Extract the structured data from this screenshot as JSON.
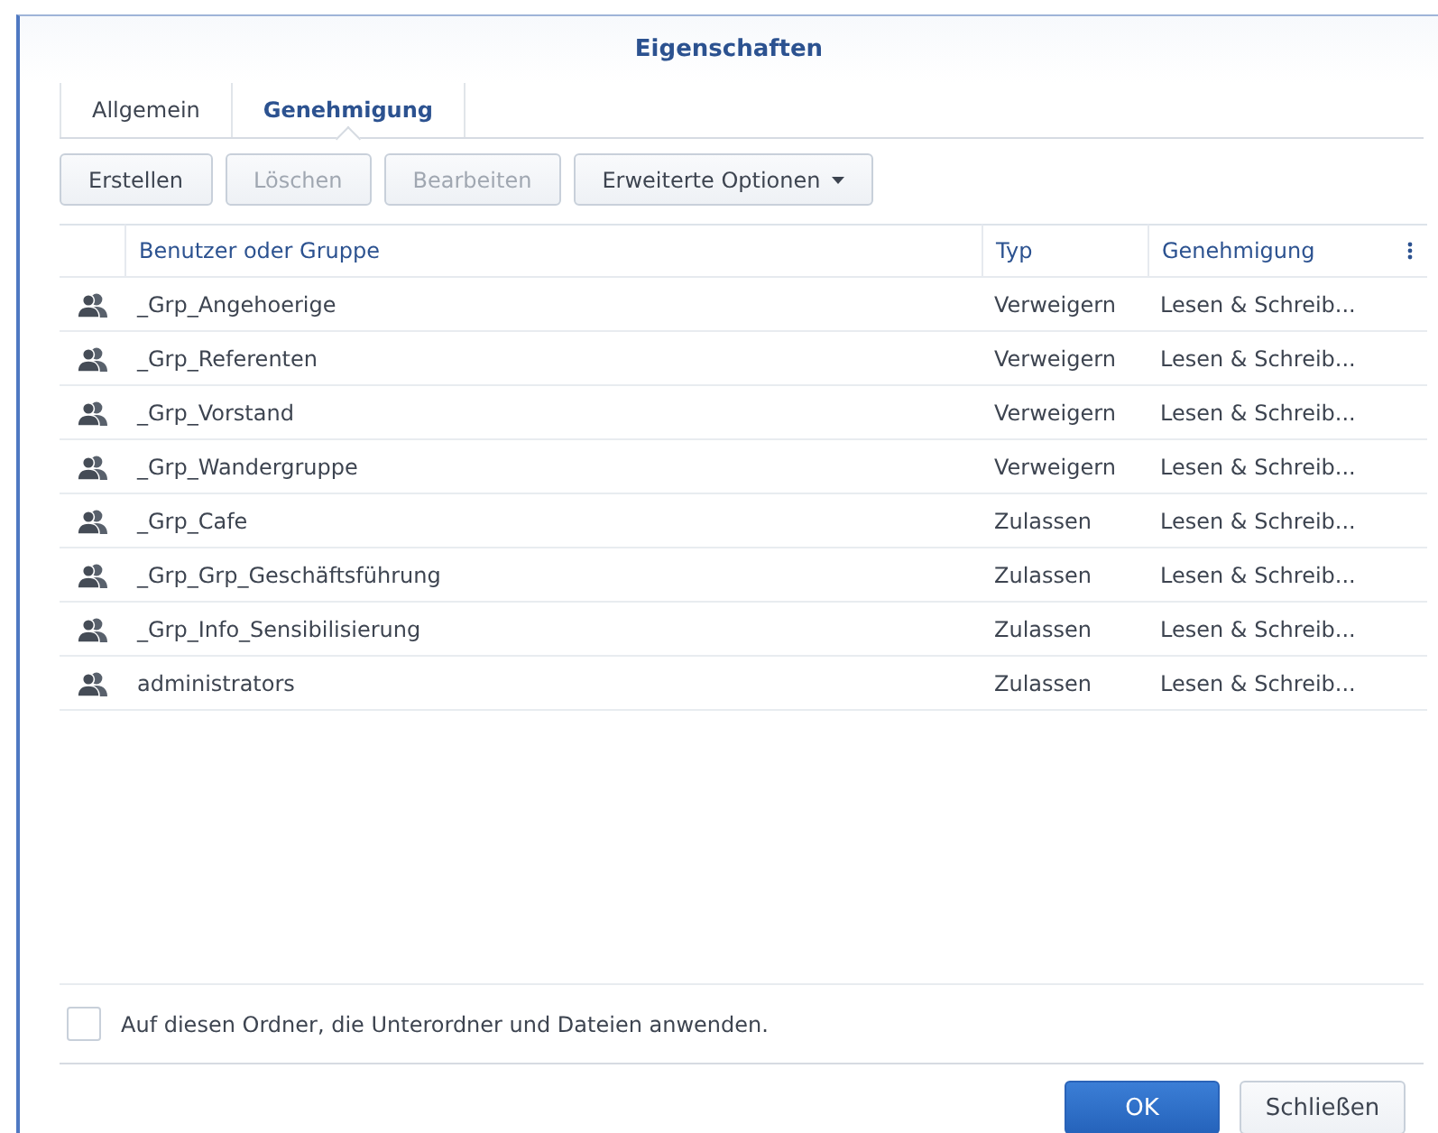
{
  "window": {
    "title": "Eigenschaften"
  },
  "tabs": [
    {
      "label": "Allgemein",
      "selected": false
    },
    {
      "label": "Genehmigung",
      "selected": true
    }
  ],
  "toolbar": [
    {
      "label": "Erstellen",
      "disabled": false,
      "dropdown": false
    },
    {
      "label": "Löschen",
      "disabled": true,
      "dropdown": false
    },
    {
      "label": "Bearbeiten",
      "disabled": true,
      "dropdown": false
    },
    {
      "label": "Erweiterte Optionen",
      "disabled": false,
      "dropdown": true
    }
  ],
  "table": {
    "columns": [
      "Benutzer oder Gruppe",
      "Typ",
      "Genehmigung"
    ],
    "rows": [
      {
        "name": "_Grp_Angehoerige",
        "type": "Verweigern",
        "permission": "Lesen & Schreib..."
      },
      {
        "name": "_Grp_Referenten",
        "type": "Verweigern",
        "permission": "Lesen & Schreib..."
      },
      {
        "name": "_Grp_Vorstand",
        "type": "Verweigern",
        "permission": "Lesen & Schreib..."
      },
      {
        "name": "_Grp_Wandergruppe",
        "type": "Verweigern",
        "permission": "Lesen & Schreib..."
      },
      {
        "name": "_Grp_Cafe",
        "type": "Zulassen",
        "permission": "Lesen & Schreib..."
      },
      {
        "name": "_Grp_Grp_Geschäftsführung",
        "type": "Zulassen",
        "permission": "Lesen & Schreib..."
      },
      {
        "name": "_Grp_Info_Sensibilisierung",
        "type": "Zulassen",
        "permission": "Lesen & Schreib..."
      },
      {
        "name": "administrators",
        "type": "Zulassen",
        "permission": "Lesen & Schreib..."
      }
    ]
  },
  "apply_checkbox": {
    "label": "Auf diesen Ordner, die Unterordner und Dateien anwenden.",
    "checked": false
  },
  "buttons": [
    {
      "label": "OK",
      "kind": "primary"
    },
    {
      "label": "Schließen",
      "kind": "secondary"
    }
  ]
}
